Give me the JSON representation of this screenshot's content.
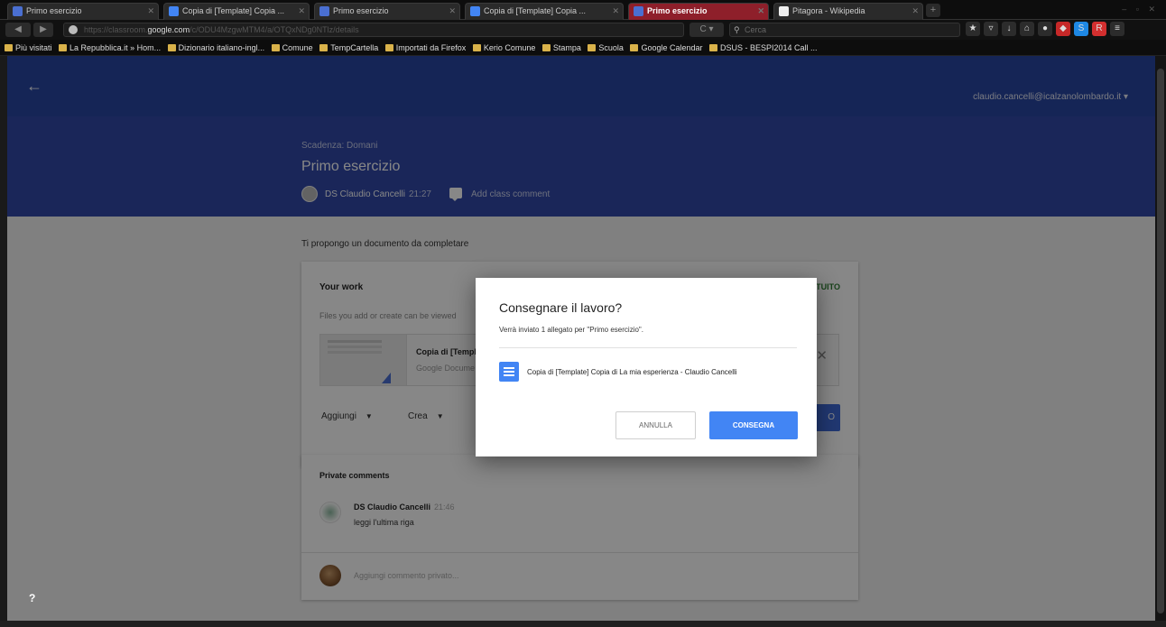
{
  "browser": {
    "tabs": [
      {
        "label": "Primo esercizio",
        "active": false,
        "favicon_color": "#4a6fd1"
      },
      {
        "label": "Copia di [Template] Copia ...",
        "active": false,
        "favicon_color": "#4285f4"
      },
      {
        "label": "Primo esercizio",
        "active": false,
        "favicon_color": "#4a6fd1"
      },
      {
        "label": "Copia di [Template] Copia ...",
        "active": false,
        "favicon_color": "#4285f4"
      },
      {
        "label": "Primo esercizio",
        "active": true,
        "favicon_color": "#4a6fd1"
      },
      {
        "label": "Pitagora - Wikipedia",
        "active": false,
        "favicon_color": "#eeeeee"
      }
    ],
    "url": {
      "prefix": "https://classroom.",
      "host": "google.com",
      "path": "/c/ODU4MzgwMTM4/a/OTQxNDg0NTlz/details"
    },
    "search_placeholder": "Cerca",
    "bookmarks": [
      "Più visitati",
      "La Repubblica.it » Hom...",
      "Dizionario italiano-ingl...",
      "Comune",
      "TempCartella",
      "Importati da Firefox",
      "Kerio Comune",
      "Stampa",
      "Scuola",
      "Google Calendar",
      "DSUS - BESPI2014 Call ..."
    ]
  },
  "topbar": {
    "account": "claudio.cancelli@icalzanolombardo.it ▾"
  },
  "assignment": {
    "due": "Scadenza: Domani",
    "title": "Primo esercizio",
    "author": "DS Claudio Cancelli",
    "time": "21:27",
    "comment_link": "Add class comment",
    "description": "Ti propongo un documento da completare"
  },
  "work": {
    "title": "Your work",
    "status": "TUITO",
    "subtitle": "Files you add or create can be viewed",
    "attachment_name": "Copia di [Templ",
    "attachment_type": "Google Docume",
    "add_label": "Aggiungi",
    "create_label": "Crea",
    "turnin_label": "O"
  },
  "private_comments": {
    "title": "Private comments",
    "author": "DS Claudio Cancelli",
    "time": "21:46",
    "text": "leggi l'ultima riga",
    "input_placeholder": "Aggiungi commento privato..."
  },
  "dialog": {
    "title": "Consegnare il lavoro?",
    "body": "Verrà inviato 1 allegato per \"Primo esercizio\".",
    "document": "Copia di [Template] Copia di La mia esperienza - Claudio Cancelli",
    "cancel": "ANNULLA",
    "confirm": "CONSEGNA"
  },
  "help": "?",
  "colors": {
    "header_blue": "#3149a8",
    "topbar_blue": "#2946a2",
    "primary": "#4285f4",
    "active_tab": "#8e1f2a",
    "status_green": "#2e7d32"
  }
}
